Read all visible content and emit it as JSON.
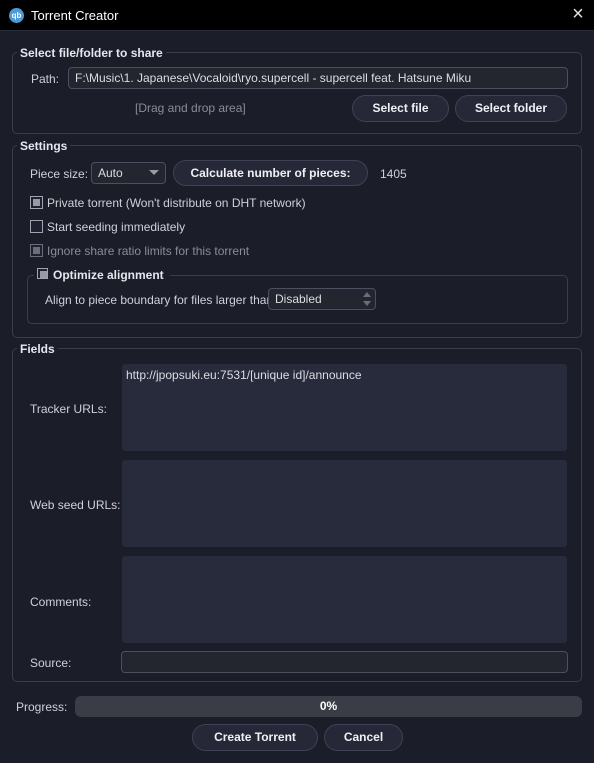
{
  "window": {
    "title": "Torrent Creator",
    "app_icon": "qb",
    "close_icon": "close-icon"
  },
  "select_group": {
    "title": "Select file/folder to share",
    "path_label": "Path:",
    "path_value": "F:\\Music\\1. Japanese\\Vocaloid\\ryo.supercell - supercell feat. Hatsune Miku",
    "drag_drop": "[Drag and drop area]",
    "select_file": "Select file",
    "select_folder": "Select folder"
  },
  "settings": {
    "title": "Settings",
    "piece_size_label": "Piece size:",
    "piece_size_value": "Auto",
    "calc_button": "Calculate number of pieces:",
    "pieces_count": "1405",
    "private_torrent": {
      "label": "Private torrent (Won't distribute on DHT network)",
      "checked": true
    },
    "start_seeding": {
      "label": "Start seeding immediately",
      "checked": false
    },
    "ignore_ratio": {
      "label": "Ignore share ratio limits for this torrent",
      "checked": true,
      "disabled": true
    },
    "optimize": {
      "title": "Optimize alignment",
      "checked": true,
      "align_label": "Align to piece boundary for files larger than:",
      "align_value": "Disabled"
    }
  },
  "fields": {
    "title": "Fields",
    "tracker_label": "Tracker URLs:",
    "tracker_value": "http://jpopsuki.eu:7531/[unique id]/announce",
    "webseed_label": "Web seed URLs:",
    "webseed_value": "",
    "comments_label": "Comments:",
    "comments_value": "",
    "source_label": "Source:",
    "source_value": ""
  },
  "progress": {
    "label": "Progress:",
    "value": 0,
    "text": "0%"
  },
  "buttons": {
    "create": "Create Torrent",
    "cancel": "Cancel"
  },
  "colors": {
    "background": "#1b1d28",
    "border": "#3a3d4c",
    "field": "#282b3c",
    "accent_icon": "#4a9ad8"
  }
}
